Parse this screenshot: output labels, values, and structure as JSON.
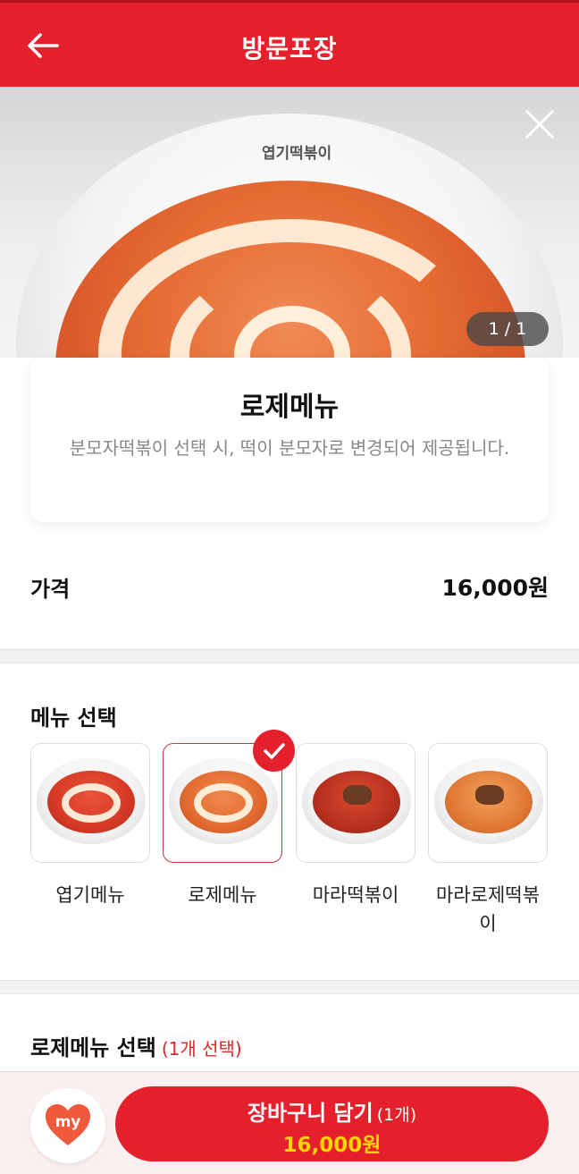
{
  "header": {
    "title": "방문포장"
  },
  "hero": {
    "brand_text": "엽기떡볶이",
    "pager": "1 / 1"
  },
  "product": {
    "name": "로제메뉴",
    "description": "분모자떡볶이 선택 시, 떡이 분모자로 변경되어 제공됩니다."
  },
  "price": {
    "label": "가격",
    "value": "16,000원"
  },
  "menu_section": {
    "title": "메뉴 선택",
    "options": [
      {
        "label": "엽기메뉴",
        "selected": false
      },
      {
        "label": "로제메뉴",
        "selected": true
      },
      {
        "label": "마라떡볶이",
        "selected": false
      },
      {
        "label": "마라로제떡볶이",
        "selected": false
      }
    ]
  },
  "rose_section": {
    "title": "로제메뉴 선택",
    "sub": "(1개 선택)"
  },
  "bottom": {
    "my_label": "my",
    "cart_label": "장바구니 담기",
    "cart_count": "(1개)",
    "cart_price": "16,000원"
  },
  "colors": {
    "brand_red": "#e3202b",
    "price_yellow": "#ffd400",
    "sub_red": "#d62a2a"
  }
}
